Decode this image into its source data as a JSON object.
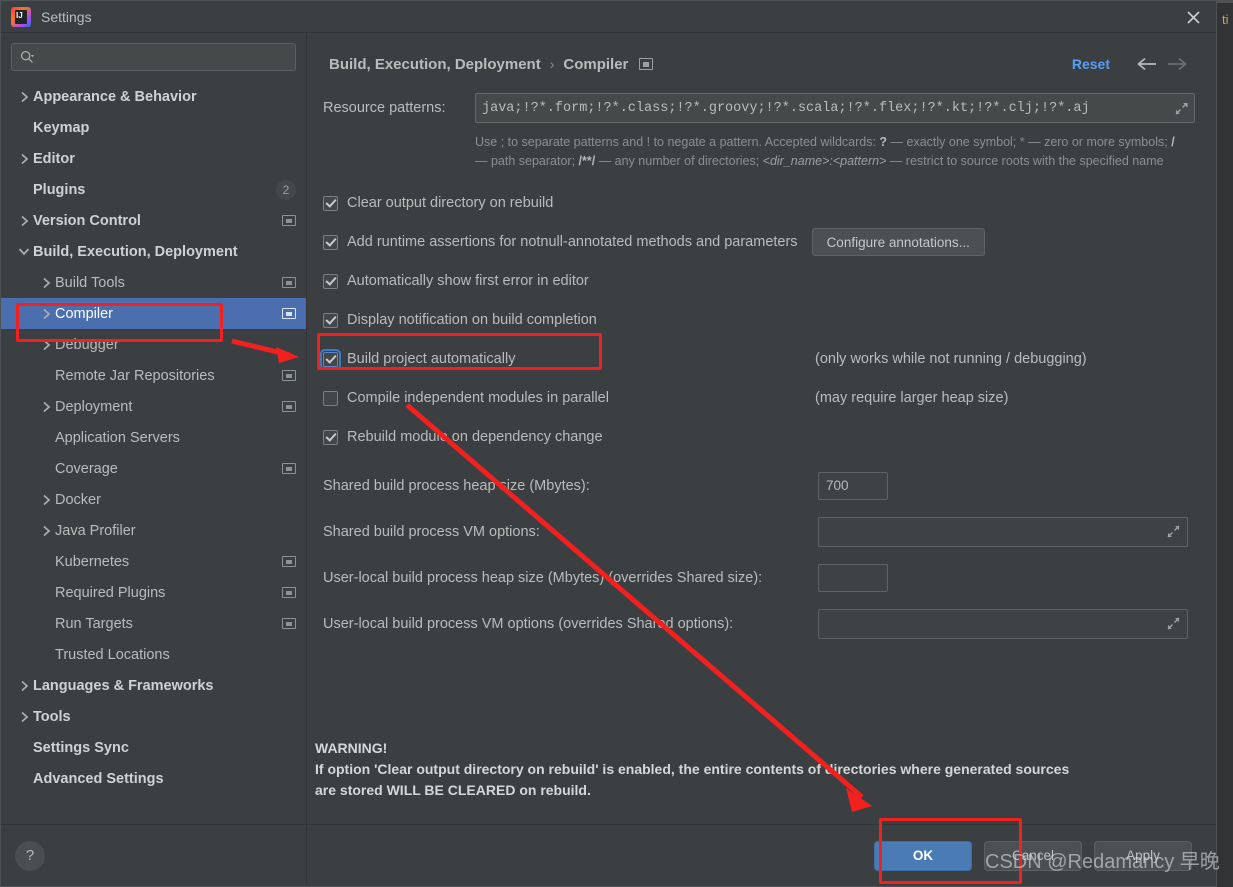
{
  "window": {
    "title": "Settings",
    "logo_icon": "intellij-idea-logo",
    "close_icon": "close-icon",
    "backdrop_text": "ti"
  },
  "search": {
    "placeholder": "",
    "value": "",
    "icon": "search-icon"
  },
  "sidebar": {
    "items": [
      {
        "label": "Appearance & Behavior",
        "indent": 0,
        "arrow": "chevron-right",
        "bold": true,
        "selected": false,
        "badge": null,
        "project_icon": false
      },
      {
        "label": "Keymap",
        "indent": 0,
        "arrow": "",
        "bold": true,
        "selected": false,
        "badge": null,
        "project_icon": false
      },
      {
        "label": "Editor",
        "indent": 0,
        "arrow": "chevron-right",
        "bold": true,
        "selected": false,
        "badge": null,
        "project_icon": false
      },
      {
        "label": "Plugins",
        "indent": 0,
        "arrow": "",
        "bold": true,
        "selected": false,
        "badge": "2",
        "project_icon": false
      },
      {
        "label": "Version Control",
        "indent": 0,
        "arrow": "chevron-right",
        "bold": true,
        "selected": false,
        "badge": null,
        "project_icon": true
      },
      {
        "label": "Build, Execution, Deployment",
        "indent": 0,
        "arrow": "chevron-down",
        "bold": true,
        "selected": false,
        "badge": null,
        "project_icon": false
      },
      {
        "label": "Build Tools",
        "indent": 1,
        "arrow": "chevron-right",
        "bold": false,
        "selected": false,
        "badge": null,
        "project_icon": true
      },
      {
        "label": "Compiler",
        "indent": 1,
        "arrow": "chevron-right",
        "bold": false,
        "selected": true,
        "badge": null,
        "project_icon": true
      },
      {
        "label": "Debugger",
        "indent": 1,
        "arrow": "chevron-right",
        "bold": false,
        "selected": false,
        "badge": null,
        "project_icon": false
      },
      {
        "label": "Remote Jar Repositories",
        "indent": 1,
        "arrow": "",
        "bold": false,
        "selected": false,
        "badge": null,
        "project_icon": true
      },
      {
        "label": "Deployment",
        "indent": 1,
        "arrow": "chevron-right",
        "bold": false,
        "selected": false,
        "badge": null,
        "project_icon": true
      },
      {
        "label": "Application Servers",
        "indent": 1,
        "arrow": "",
        "bold": false,
        "selected": false,
        "badge": null,
        "project_icon": false
      },
      {
        "label": "Coverage",
        "indent": 1,
        "arrow": "",
        "bold": false,
        "selected": false,
        "badge": null,
        "project_icon": true
      },
      {
        "label": "Docker",
        "indent": 1,
        "arrow": "chevron-right",
        "bold": false,
        "selected": false,
        "badge": null,
        "project_icon": false
      },
      {
        "label": "Java Profiler",
        "indent": 1,
        "arrow": "chevron-right",
        "bold": false,
        "selected": false,
        "badge": null,
        "project_icon": false
      },
      {
        "label": "Kubernetes",
        "indent": 1,
        "arrow": "",
        "bold": false,
        "selected": false,
        "badge": null,
        "project_icon": true
      },
      {
        "label": "Required Plugins",
        "indent": 1,
        "arrow": "",
        "bold": false,
        "selected": false,
        "badge": null,
        "project_icon": true
      },
      {
        "label": "Run Targets",
        "indent": 1,
        "arrow": "",
        "bold": false,
        "selected": false,
        "badge": null,
        "project_icon": true
      },
      {
        "label": "Trusted Locations",
        "indent": 1,
        "arrow": "",
        "bold": false,
        "selected": false,
        "badge": null,
        "project_icon": false
      },
      {
        "label": "Languages & Frameworks",
        "indent": 0,
        "arrow": "chevron-right",
        "bold": true,
        "selected": false,
        "badge": null,
        "project_icon": false
      },
      {
        "label": "Tools",
        "indent": 0,
        "arrow": "chevron-right",
        "bold": true,
        "selected": false,
        "badge": null,
        "project_icon": false
      },
      {
        "label": "Settings Sync",
        "indent": 0,
        "arrow": "",
        "bold": true,
        "selected": false,
        "badge": null,
        "project_icon": false
      },
      {
        "label": "Advanced Settings",
        "indent": 0,
        "arrow": "",
        "bold": true,
        "selected": false,
        "badge": null,
        "project_icon": false
      }
    ],
    "help_label": "?",
    "help_icon": "help-question-icon"
  },
  "main": {
    "breadcrumb": {
      "parent": "Build, Execution, Deployment",
      "separator": "›",
      "current": "Compiler",
      "project_icon": "project-scope-icon"
    },
    "reset_label": "Reset",
    "back_icon": "arrow-left-icon",
    "forward_icon": "arrow-right-icon",
    "resource_patterns": {
      "label": "Resource patterns:",
      "value": "java;!?*.form;!?*.class;!?*.groovy;!?*.scala;!?*.flex;!?*.kt;!?*.clj;!?*.aj",
      "expand_icon": "expand-icon"
    },
    "hint": {
      "part1": "Use ; to separate patterns and ! to negate a pattern. Accepted wildcards: ",
      "b1": "?",
      "part2": " — exactly one symbol; * — zero or more symbols; ",
      "b2": "/",
      "part3": " — path separator; ",
      "b3": "/**/",
      "part4": " — any number of directories; ",
      "i1": "<dir_name>:<pattern>",
      "part5": " — restrict to source roots with the specified name"
    },
    "checkboxes": [
      {
        "label": "Clear output directory on rebuild",
        "checked": true,
        "focused": false,
        "note": "",
        "button": ""
      },
      {
        "label": "Add runtime assertions for notnull-annotated methods and parameters",
        "checked": true,
        "focused": false,
        "note": "",
        "button": "Configure annotations..."
      },
      {
        "label": "Automatically show first error in editor",
        "checked": true,
        "focused": false,
        "note": "",
        "button": ""
      },
      {
        "label": "Display notification on build completion",
        "checked": true,
        "focused": false,
        "note": "",
        "button": ""
      },
      {
        "label": "Build project automatically",
        "checked": true,
        "focused": true,
        "note": "(only works while not running / debugging)",
        "button": ""
      },
      {
        "label": "Compile independent modules in parallel",
        "checked": false,
        "focused": false,
        "note": "(may require larger heap size)",
        "button": ""
      },
      {
        "label": "Rebuild module on dependency change",
        "checked": true,
        "focused": false,
        "note": "",
        "button": ""
      }
    ],
    "fields": [
      {
        "label": "Shared build process heap size (Mbytes):",
        "value": "700",
        "kind": "num"
      },
      {
        "label": "Shared build process VM options:",
        "value": "",
        "kind": "wide"
      },
      {
        "label": "User-local build process heap size (Mbytes) (overrides Shared size):",
        "value": "",
        "kind": "num"
      },
      {
        "label": "User-local build process VM options (overrides Shared options):",
        "value": "",
        "kind": "wide"
      }
    ],
    "warning": {
      "title": "WARNING!",
      "line1": "If option 'Clear output directory on rebuild' is enabled, the entire contents of directories where generated sources",
      "line2": "are stored WILL BE CLEARED on rebuild."
    }
  },
  "footer": {
    "ok_label": "OK",
    "cancel_label": "Cancel",
    "apply_label": "Apply"
  },
  "annotations": {
    "color": "#f32020",
    "watermark": "CSDN @Redamancy 早晚"
  }
}
